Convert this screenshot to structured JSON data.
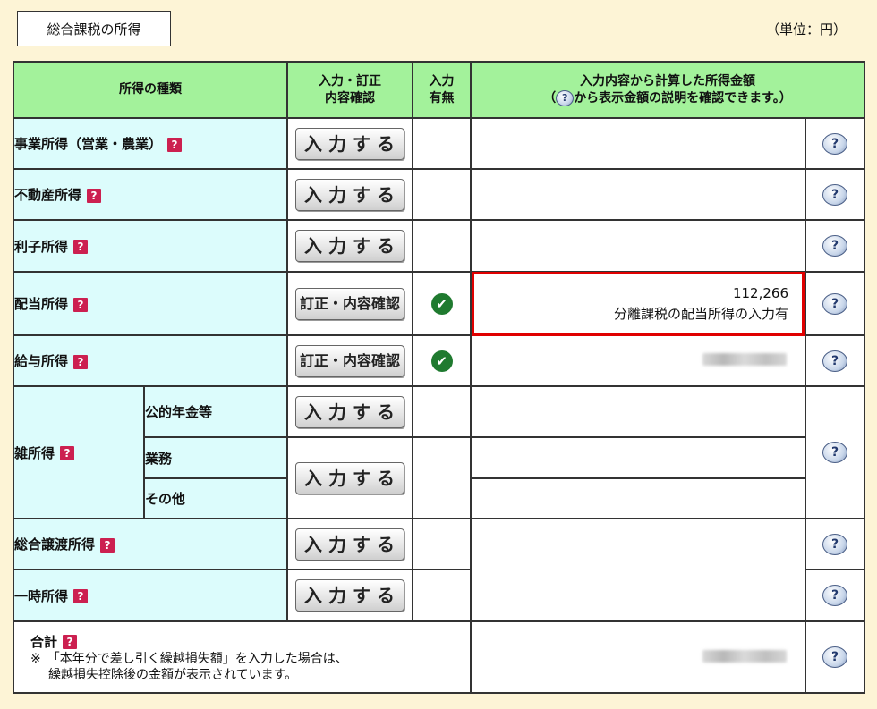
{
  "section_title": "総合課税の所得",
  "unit_label": "（単位：円）",
  "header": {
    "type_label": "所得の種類",
    "input_line1": "入力・訂正",
    "input_line2": "内容確認",
    "flag_line1": "入力",
    "flag_line2": "有無",
    "amount_line1": "入力内容から計算した所得金額",
    "amount_line2_pre": "（",
    "amount_line2_post": "から表示金額の説明を確認できます。）"
  },
  "help_glyph": "?",
  "rows": {
    "business": {
      "label": "事業所得（営業・農業）",
      "button": "入力する"
    },
    "realestate": {
      "label": "不動産所得",
      "button": "入力する"
    },
    "interest": {
      "label": "利子所得",
      "button": "入力する"
    },
    "dividend": {
      "label": "配当所得",
      "button": "訂正・内容確認",
      "amount": "112,266",
      "amount_note": "分離課税の配当所得の入力有"
    },
    "salary": {
      "label": "給与所得",
      "button": "訂正・内容確認"
    },
    "misc": {
      "label": "雑所得",
      "pension": {
        "label": "公的年金等",
        "button": "入力する"
      },
      "work": {
        "label": "業務"
      },
      "other": {
        "label": "その他"
      },
      "shared_button": "入力する"
    },
    "transfer": {
      "label": "総合譲渡所得",
      "button": "入力する"
    },
    "temporary": {
      "label": "一時所得",
      "button": "入力する"
    },
    "total": {
      "label": "合計",
      "note_line1": "※　「本年分で差し引く繰越損失額」を入力した場合は、",
      "note_line2": "繰越損失控除後の金額が表示されています。"
    }
  },
  "colors": {
    "header_bg": "#a3f29b",
    "label_bg": "#dcfcfc",
    "page_bg": "#fdf4d6",
    "highlight": "#e00000",
    "check": "#1f7a2f"
  },
  "icons": {
    "checkmark": "✔",
    "help": "question-balloon-icon"
  }
}
